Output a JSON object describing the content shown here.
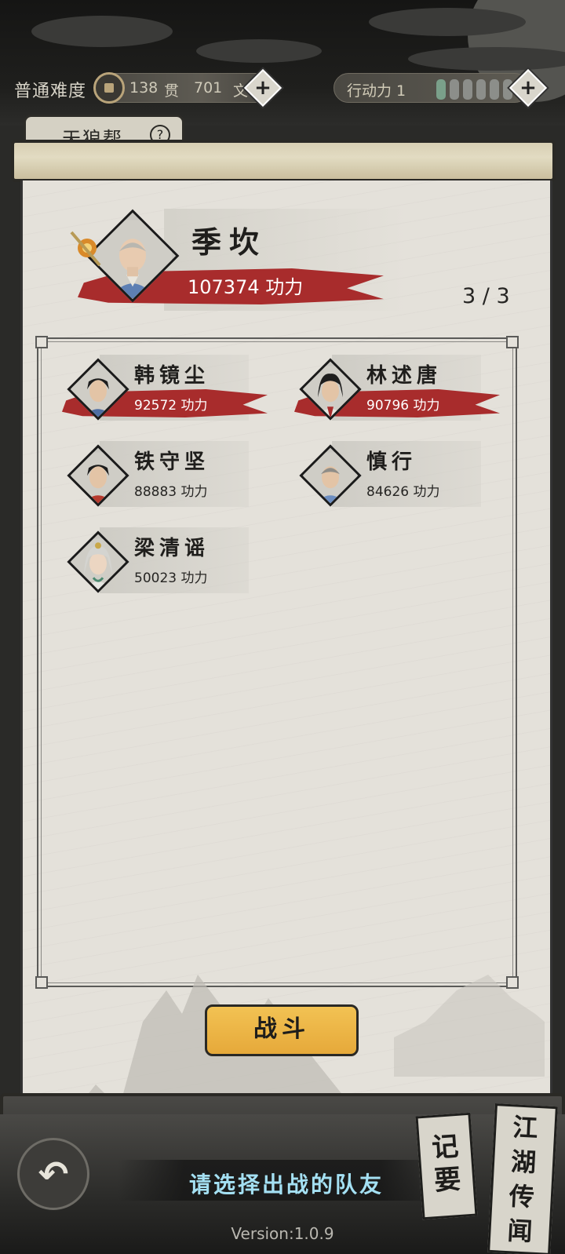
{
  "header": {
    "difficulty": "普通难度",
    "currency": {
      "guan_value": "138",
      "guan_unit": "贯",
      "wen_value": "701",
      "wen_unit": "文"
    },
    "stamina": {
      "label": "行动力 1",
      "pips_total": 7,
      "pips_on": 1
    }
  },
  "tab": {
    "name": "天狼帮",
    "help": "?"
  },
  "leader": {
    "name": "季坎",
    "power": "107374 功力",
    "icon": "monk-portrait"
  },
  "team_count": "3 / 3",
  "roster": [
    {
      "name": "韩镜尘",
      "power": "92572 功力",
      "selected": true,
      "icon": "swordsman-portrait"
    },
    {
      "name": "林述唐",
      "power": "90796 功力",
      "selected": true,
      "icon": "swordsman-portrait"
    },
    {
      "name": "铁守坚",
      "power": "88883 功力",
      "selected": false,
      "icon": "warrior-portrait"
    },
    {
      "name": "慎行",
      "power": "84626 功力",
      "selected": false,
      "icon": "monk-portrait"
    },
    {
      "name": "梁清谣",
      "power": "50023 功力",
      "selected": false,
      "icon": "maiden-portrait"
    }
  ],
  "fight_button": "战斗",
  "hint": "请选择出战的队友",
  "version": "Version:1.0.9",
  "side_buttons": {
    "notes": "记要",
    "rumors": "江湖传闻"
  },
  "colors": {
    "accent_red": "#a82c2c",
    "button_gold": "#f2c253",
    "hint_blue": "#a4e0f3"
  }
}
